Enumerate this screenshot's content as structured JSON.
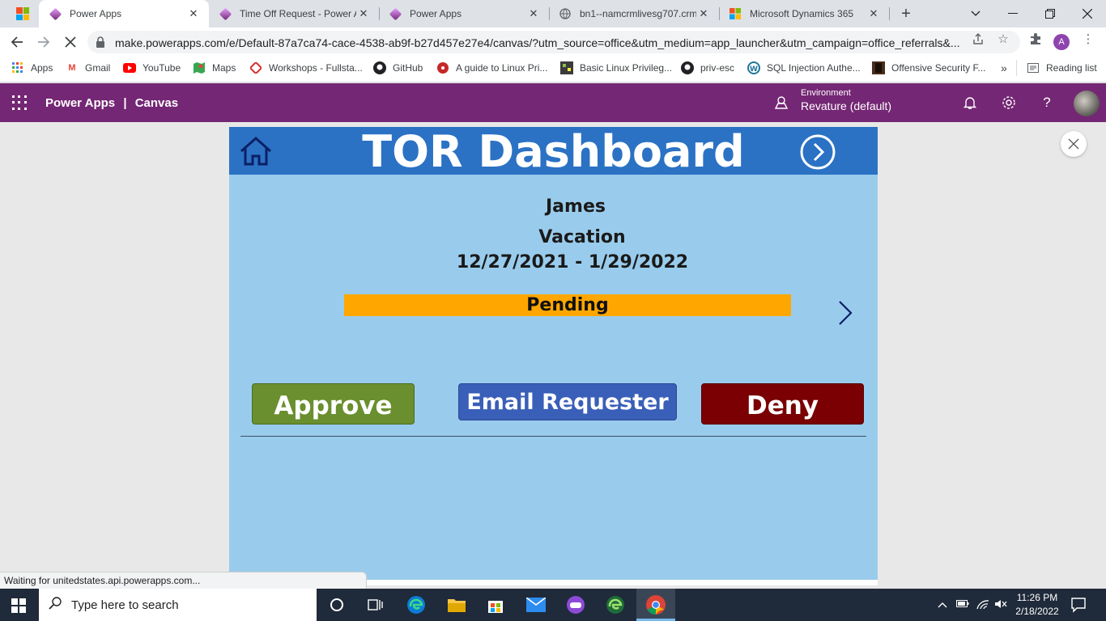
{
  "browser": {
    "tabs": [
      {
        "title": "Power Apps",
        "active": true
      },
      {
        "title": "Time Off Request - Power A",
        "active": false
      },
      {
        "title": "Power Apps",
        "active": false
      },
      {
        "title": "bn1--namcrmlivesg707.crm",
        "active": false
      },
      {
        "title": "Microsoft Dynamics 365",
        "active": false
      }
    ],
    "url": "make.powerapps.com/e/Default-87a7ca74-cace-4538-ab9f-b27d457e27e4/canvas/?utm_source=office&utm_medium=app_launcher&utm_campaign=office_referrals&...",
    "profile_initial": "A",
    "bookmarks": [
      {
        "label": "Apps",
        "icon": "apps-grid-icon"
      },
      {
        "label": "Gmail",
        "icon": "gmail-icon"
      },
      {
        "label": "YouTube",
        "icon": "youtube-icon"
      },
      {
        "label": "Maps",
        "icon": "maps-icon"
      },
      {
        "label": "Workshops - Fullsta...",
        "icon": "workshops-icon"
      },
      {
        "label": "GitHub",
        "icon": "github-icon"
      },
      {
        "label": "A guide to Linux Pri...",
        "icon": "red-dot-icon"
      },
      {
        "label": "Basic Linux Privileg...",
        "icon": "pixel-icon"
      },
      {
        "label": "priv-esc",
        "icon": "github-icon"
      },
      {
        "label": "SQL Injection Authe...",
        "icon": "wordpress-icon"
      },
      {
        "label": "Offensive Security F...",
        "icon": "offsec-icon"
      }
    ],
    "bookmarks_overflow": "»",
    "reading_list": "Reading list",
    "status_text": "Waiting for unitedstates.api.powerapps.com..."
  },
  "powerapps_header": {
    "brand": "Power Apps",
    "separator": "|",
    "section": "Canvas",
    "environment_label": "Environment",
    "environment_value": "Revature (default)"
  },
  "app": {
    "title": "TOR Dashboard",
    "requester_name": "James",
    "request_type": "Vacation",
    "date_range": "12/27/2021 - 1/29/2022",
    "status": "Pending",
    "buttons": {
      "approve": "Approve",
      "email": "Email Requester",
      "deny": "Deny"
    },
    "colors": {
      "header": "#2b72c4",
      "background": "#99ccec",
      "status_pending": "#ffa700",
      "approve": "#6a8f2e",
      "email": "#3a5fb8",
      "deny": "#7a0003"
    }
  },
  "taskbar": {
    "search_placeholder": "Type here to search",
    "time": "11:26 PM",
    "date": "2/18/2022"
  }
}
